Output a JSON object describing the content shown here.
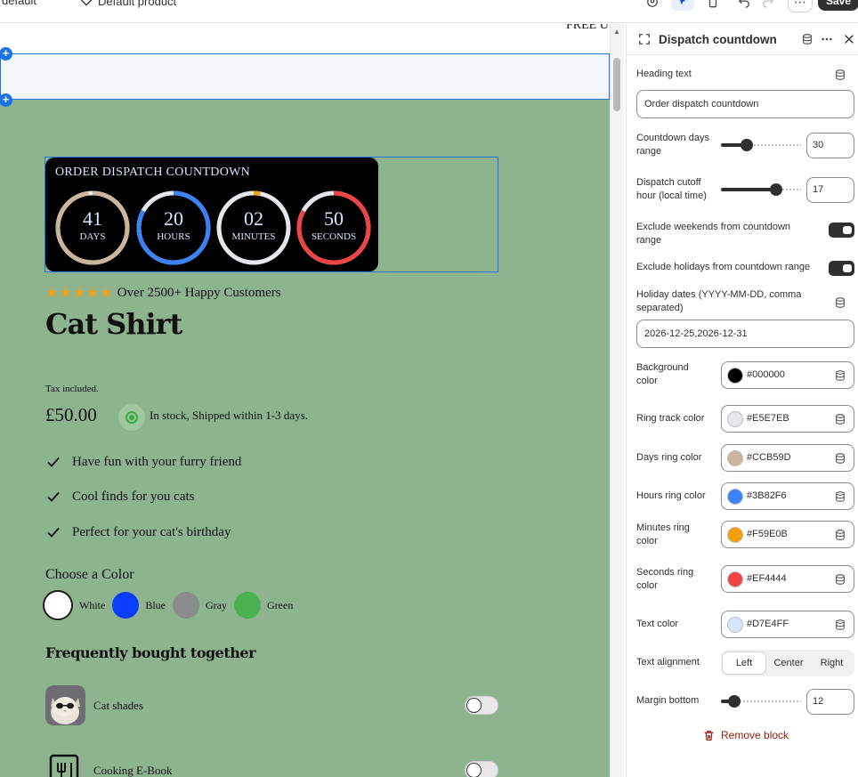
{
  "topbar": {
    "theme_crumb": "default",
    "template_crumb": "Default product",
    "more_label": "⋯",
    "save_label": "Save"
  },
  "canvas": {
    "announcement": "FREE U",
    "countdown": {
      "heading": "ORDER DISPATCH COUNTDOWN",
      "rings": [
        {
          "value": "41",
          "label": "DAYS",
          "color": "#CCB59D",
          "progress": 0.98
        },
        {
          "value": "20",
          "label": "HOURS",
          "color": "#3B82F6",
          "progress": 0.83
        },
        {
          "value": "02",
          "label": "MINUTES",
          "color": "#F59E0B",
          "progress": 0.03
        },
        {
          "value": "50",
          "label": "SECONDS",
          "color": "#EF4444",
          "progress": 0.83
        }
      ],
      "track_color": "#E5E7EB",
      "background": "#000000"
    },
    "product": {
      "stars": "★★★★★",
      "rating_text": "Over 2500+ Happy Customers",
      "title": "Cat Shirt",
      "tax_note": "Tax included.",
      "price": "£50.00",
      "stock_text": "In stock, Shipped within 1-3 days.",
      "features": [
        "Have fun with your furry friend",
        "Cool finds for you cats",
        "Perfect for your cat's birthday"
      ],
      "color_title": "Choose a Color",
      "colors": [
        {
          "name": "White",
          "hex": "#ffffff"
        },
        {
          "name": "Blue",
          "hex": "#0a3dfb"
        },
        {
          "name": "Gray",
          "hex": "#8b8b8b"
        },
        {
          "name": "Green",
          "hex": "#4caf50"
        }
      ],
      "fbt_title": "Frequently bought together",
      "fbt_items": [
        "Cat shades",
        "Cooking E-Book"
      ]
    }
  },
  "panel": {
    "title": "Dispatch countdown",
    "heading_text_label": "Heading text",
    "heading_text_value": "Order dispatch countdown",
    "days_range_label": "Countdown days range",
    "days_range_value": "30",
    "cutoff_label": "Dispatch cutoff hour (local time)",
    "cutoff_value": "17",
    "exclude_weekends_label": "Exclude weekends from countdown range",
    "exclude_weekends_on": true,
    "exclude_holidays_label": "Exclude holidays from countdown range",
    "exclude_holidays_on": true,
    "holiday_dates_label": "Holiday dates (YYYY-MM-DD, comma separated)",
    "holiday_dates_value": "2026-12-25,2026-12-31",
    "colors": [
      {
        "label": "Background color",
        "hex": "#000000"
      },
      {
        "label": "Ring track color",
        "hex": "#E5E7EB"
      },
      {
        "label": "Days ring color",
        "hex": "#CCB59D"
      },
      {
        "label": "Hours ring color",
        "hex": "#3B82F6"
      },
      {
        "label": "Minutes ring color",
        "hex": "#F59E0B"
      },
      {
        "label": "Seconds ring color",
        "hex": "#EF4444"
      },
      {
        "label": "Text color",
        "hex": "#D7E4FF"
      }
    ],
    "alignment_label": "Text alignment",
    "alignment_options": [
      "Left",
      "Center",
      "Right"
    ],
    "alignment_selected": "Left",
    "margin_label": "Margin bottom",
    "margin_value": "12",
    "remove_label": "Remove block"
  }
}
